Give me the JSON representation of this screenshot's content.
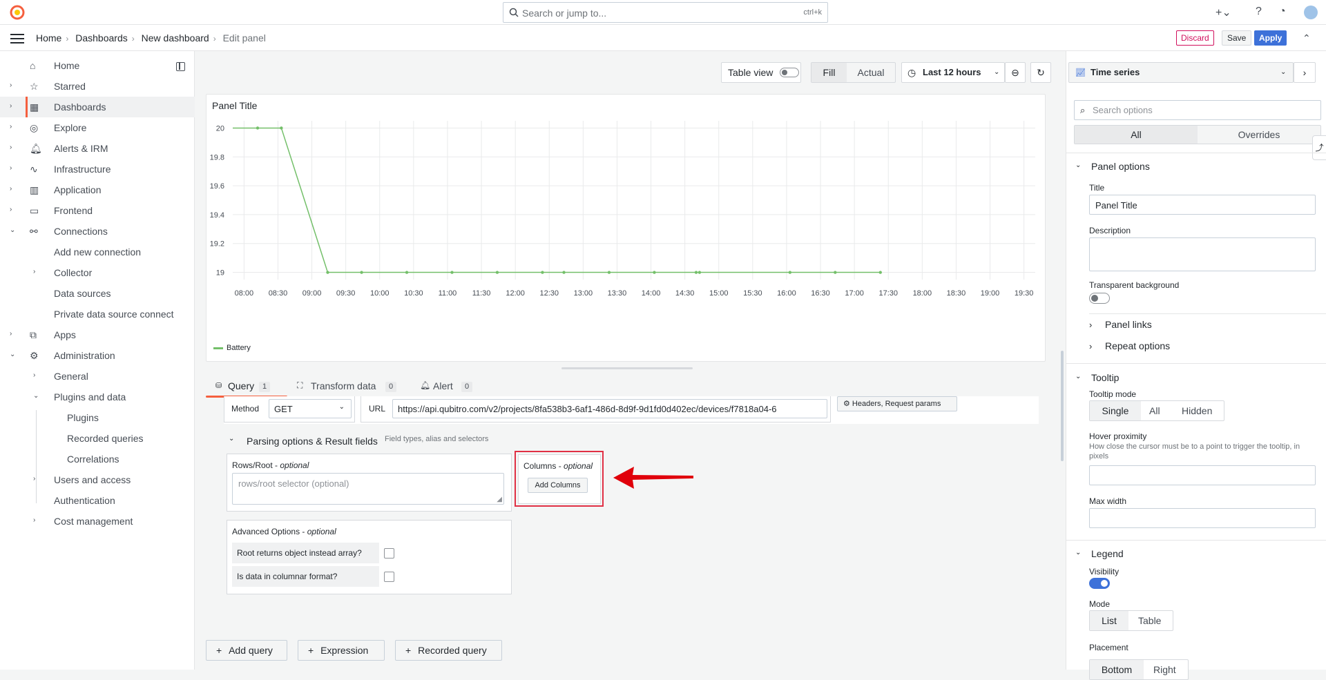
{
  "search": {
    "placeholder": "Search or jump to...",
    "shortcut": "ctrl+k"
  },
  "breadcrumb": [
    "Home",
    "Dashboards",
    "New dashboard",
    "Edit panel"
  ],
  "header_actions": {
    "discard": "Discard",
    "save": "Save",
    "apply": "Apply"
  },
  "sidebar": {
    "items": [
      {
        "label": "Home",
        "chevron": ""
      },
      {
        "label": "Starred",
        "chevron": "›"
      },
      {
        "label": "Dashboards",
        "chevron": "›"
      },
      {
        "label": "Explore",
        "chevron": "›"
      },
      {
        "label": "Alerts & IRM",
        "chevron": "›"
      },
      {
        "label": "Infrastructure",
        "chevron": "›"
      },
      {
        "label": "Application",
        "chevron": "›"
      },
      {
        "label": "Frontend",
        "chevron": "›"
      },
      {
        "label": "Connections",
        "chevron": "⌄"
      },
      {
        "label": "Add new connection",
        "chevron": ""
      },
      {
        "label": "Collector",
        "chevron": "›"
      },
      {
        "label": "Data sources",
        "chevron": ""
      },
      {
        "label": "Private data source connect",
        "chevron": ""
      },
      {
        "label": "Apps",
        "chevron": "›"
      },
      {
        "label": "Administration",
        "chevron": "⌄"
      },
      {
        "label": "General",
        "chevron": "›"
      },
      {
        "label": "Plugins and data",
        "chevron": "⌄"
      },
      {
        "label": "Plugins",
        "chevron": ""
      },
      {
        "label": "Recorded queries",
        "chevron": ""
      },
      {
        "label": "Correlations",
        "chevron": ""
      },
      {
        "label": "Users and access",
        "chevron": "›"
      },
      {
        "label": "Authentication",
        "chevron": ""
      },
      {
        "label": "Cost management",
        "chevron": "›"
      }
    ]
  },
  "toolbar": {
    "table_view": "Table view",
    "fill": "Fill",
    "actual": "Actual",
    "time_range": "Last 12 hours"
  },
  "panel": {
    "title": "Panel Title",
    "legend": "Battery"
  },
  "chart_data": {
    "type": "line",
    "series": [
      {
        "name": "Battery",
        "color": "#73bf69",
        "x": [
          "08:12",
          "08:33",
          "09:14",
          "09:44",
          "10:24",
          "11:04",
          "11:44",
          "12:24",
          "12:43",
          "13:23",
          "14:03",
          "14:40",
          "14:43",
          "16:03",
          "16:43",
          "17:23"
        ],
        "values": [
          20,
          20,
          19,
          19,
          19,
          19,
          19,
          19,
          19,
          19,
          19,
          19,
          19,
          19,
          19,
          19
        ]
      }
    ],
    "x_ticks": [
      "08:00",
      "08:30",
      "09:00",
      "09:30",
      "10:00",
      "10:30",
      "11:00",
      "11:30",
      "12:00",
      "12:30",
      "13:00",
      "13:30",
      "14:00",
      "14:30",
      "15:00",
      "15:30",
      "16:00",
      "16:30",
      "17:00",
      "17:30",
      "18:00",
      "18:30",
      "19:00",
      "19:30"
    ],
    "y_ticks": [
      "19",
      "19.2",
      "19.4",
      "19.6",
      "19.8",
      "20"
    ],
    "ylim": [
      18.95,
      20.05
    ],
    "grid": true,
    "legend_position": "bottom-left"
  },
  "tabs": [
    {
      "label": "Query",
      "count": "1"
    },
    {
      "label": "Transform data",
      "count": "0"
    },
    {
      "label": "Alert",
      "count": "0"
    }
  ],
  "query": {
    "method_label": "Method",
    "method_value": "GET",
    "url_label": "URL",
    "url_value": "https://api.qubitro.com/v2/projects/8fa538b3-6af1-486d-8d9f-9d1fd0d402ec/devices/f7818a04-6",
    "headers_button": "Headers, Request params",
    "parsing_title": "Parsing options & Result fields",
    "parsing_sub": "Field types, alias and selectors",
    "rows_label": "Rows/Root",
    "rows_opt": "optional",
    "rows_placeholder": "rows/root selector (optional)",
    "columns_label": "Columns",
    "columns_opt": "optional",
    "add_columns": "Add Columns",
    "advanced_label": "Advanced Options",
    "advanced_opt": "optional",
    "root_object": "Root returns object instead array?",
    "columnar": "Is data in columnar format?"
  },
  "query_buttons": {
    "add_query": "Add query",
    "expression": "Expression",
    "recorded": "Recorded query"
  },
  "options": {
    "viz": "Time series",
    "search_placeholder": "Search options",
    "tab_all": "All",
    "tab_overrides": "Overrides",
    "panel_options": "Panel options",
    "title_label": "Title",
    "title_value": "Panel Title",
    "description_label": "Description",
    "transparent_label": "Transparent background",
    "panel_links": "Panel links",
    "repeat_options": "Repeat options",
    "tooltip": "Tooltip",
    "tooltip_mode": "Tooltip mode",
    "tooltip_modes": [
      "Single",
      "All",
      "Hidden"
    ],
    "hover_label": "Hover proximity",
    "hover_desc": "How close the cursor must be to a point to trigger the tooltip, in pixels",
    "max_width": "Max width",
    "legend": "Legend",
    "visibility": "Visibility",
    "mode": "Mode",
    "modes": [
      "List",
      "Table"
    ],
    "placement": "Placement",
    "placements": [
      "Bottom",
      "Right"
    ]
  },
  "colors": {
    "accent": "#3d71d9",
    "brand": "#f55f3e",
    "series": "#73bf69",
    "highlight": "#e02f44"
  }
}
